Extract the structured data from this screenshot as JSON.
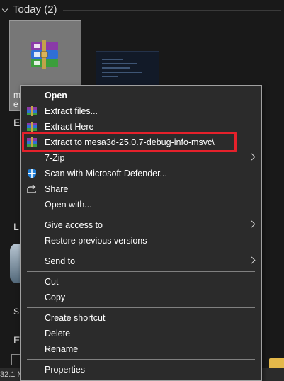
{
  "group": {
    "title": "Today (2)"
  },
  "tile": {
    "caption_line1": "m",
    "caption_line2": "e"
  },
  "left_fragments": {
    "e1": "E",
    "l": "L",
    "sh": "S",
    "e2": "E",
    "size": "32.1 M"
  },
  "menu": {
    "open": "Open",
    "extract_files": "Extract files...",
    "extract_here": "Extract Here",
    "extract_to": "Extract to mesa3d-25.0.7-debug-info-msvc\\",
    "seven_zip": "7-Zip",
    "scan": "Scan with Microsoft Defender...",
    "share": "Share",
    "open_with": "Open with...",
    "give_access": "Give access to",
    "restore": "Restore previous versions",
    "send_to": "Send to",
    "cut": "Cut",
    "copy": "Copy",
    "create_shortcut": "Create shortcut",
    "delete": "Delete",
    "rename": "Rename",
    "properties": "Properties"
  },
  "colors": {
    "background": "#191919",
    "menu_bg": "#2b2b2b",
    "highlight_outline": "#e5212b",
    "selected_tile": "#777777"
  },
  "icons": {
    "archive": "winrar-archive-icon",
    "defender": "shield-icon",
    "share": "share-icon"
  }
}
